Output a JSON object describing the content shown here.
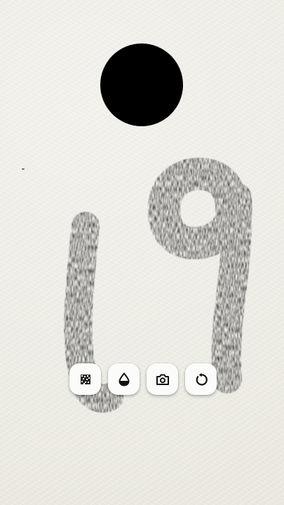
{
  "canvas": {
    "paper_color": "#efede6",
    "ink_color": "#000000",
    "pencil_color": "#2b2b2b"
  },
  "toolbar": {
    "buttons": [
      {
        "name": "texture-brush-button",
        "icon": "texture-icon"
      },
      {
        "name": "ink-drop-button",
        "icon": "ink-drop-icon"
      },
      {
        "name": "camera-button",
        "icon": "camera-icon"
      },
      {
        "name": "undo-button",
        "icon": "undo-icon"
      }
    ]
  }
}
